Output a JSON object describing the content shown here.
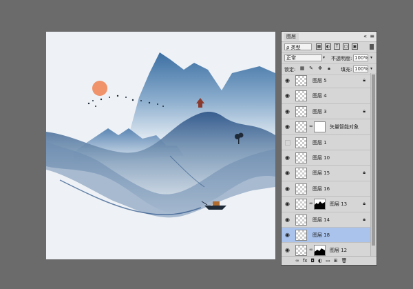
{
  "canvas": {
    "colors": {
      "sky": "#eef2f6",
      "mountain": "#3f74a8",
      "mist": "#d9e4ee",
      "sun": "#f0926a",
      "ink": "#1f2a38"
    }
  },
  "panel": {
    "tab_label": "图层",
    "close_glyph": "«",
    "menu_glyph": "≡",
    "filter": {
      "kind_label": "ρ 类型",
      "icons": [
        "pixel-filter-icon",
        "adjustment-filter-icon",
        "type-filter-icon",
        "shape-filter-icon",
        "smart-object-filter-icon"
      ]
    },
    "blend": {
      "mode": "正常",
      "opacity_label": "不透明度:",
      "opacity_value": "100%"
    },
    "lock": {
      "label": "锁定:",
      "fill_label": "填充:",
      "fill_value": "100%"
    },
    "layers": [
      {
        "name": "图层 5",
        "locked": true,
        "visible": true
      },
      {
        "name": "图层 4",
        "locked": false,
        "visible": true
      },
      {
        "name": "图层 3",
        "locked": true,
        "visible": true
      },
      {
        "name": "矢量智能对象",
        "locked": false,
        "visible": true,
        "mask": true
      },
      {
        "name": "图层 1",
        "locked": false,
        "visible": false
      },
      {
        "name": "图层 10",
        "locked": false,
        "visible": true
      },
      {
        "name": "图层 15",
        "locked": true,
        "visible": true
      },
      {
        "name": "图层 16",
        "locked": false,
        "visible": true
      },
      {
        "name": "图层 13",
        "locked": true,
        "visible": true,
        "mask": true
      },
      {
        "name": "图层 14",
        "locked": true,
        "visible": true
      },
      {
        "name": "图层 18",
        "locked": false,
        "visible": true,
        "selected": true
      },
      {
        "name": "图层 12",
        "locked": false,
        "visible": true,
        "mask": true
      }
    ],
    "footer_icons": [
      "link-layers-icon",
      "fx-icon",
      "add-mask-icon",
      "adjustment-layer-icon",
      "group-icon",
      "new-layer-icon",
      "trash-icon"
    ]
  }
}
